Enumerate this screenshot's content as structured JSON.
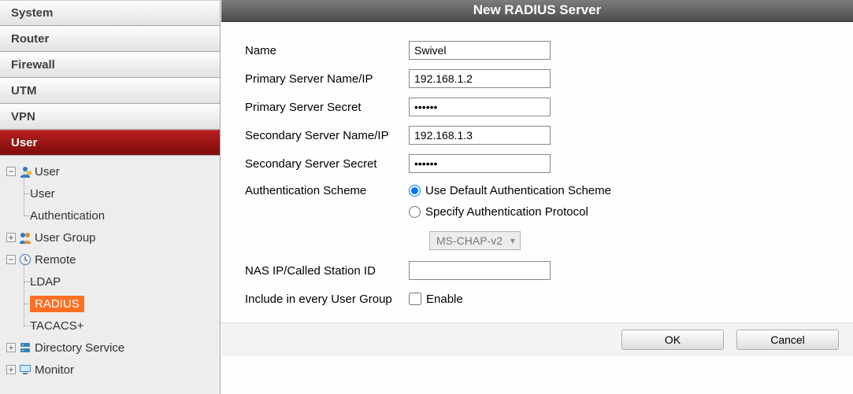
{
  "sidebar": {
    "sections": {
      "system": "System",
      "router": "Router",
      "firewall": "Firewall",
      "utm": "UTM",
      "vpn": "VPN",
      "user": "User"
    },
    "user_tree": {
      "user": {
        "label": "User",
        "children": {
          "user": "User",
          "authentication": "Authentication"
        }
      },
      "user_group": {
        "label": "User Group"
      },
      "remote": {
        "label": "Remote",
        "children": {
          "ldap": "LDAP",
          "radius": "RADIUS",
          "tacacs": "TACACS+"
        }
      },
      "directory_service": {
        "label": "Directory Service"
      },
      "monitor": {
        "label": "Monitor"
      }
    }
  },
  "panel": {
    "title": "New RADIUS Server"
  },
  "form": {
    "name": {
      "label": "Name",
      "value": "Swivel"
    },
    "primary_ip": {
      "label": "Primary Server Name/IP",
      "value": "192.168.1.2"
    },
    "primary_secret": {
      "label": "Primary Server Secret",
      "value": "••••••"
    },
    "secondary_ip": {
      "label": "Secondary Server Name/IP",
      "value": "192.168.1.3"
    },
    "secondary_secret": {
      "label": "Secondary Server Secret",
      "value": "••••••"
    },
    "auth_scheme": {
      "label": "Authentication Scheme",
      "opt_default": "Use Default Authentication Scheme",
      "opt_specify": "Specify Authentication Protocol",
      "protocol": "MS-CHAP-v2"
    },
    "nas": {
      "label": "NAS IP/Called Station ID",
      "value": ""
    },
    "include": {
      "label": "Include in every User Group",
      "option": "Enable"
    }
  },
  "buttons": {
    "ok": "OK",
    "cancel": "Cancel"
  }
}
